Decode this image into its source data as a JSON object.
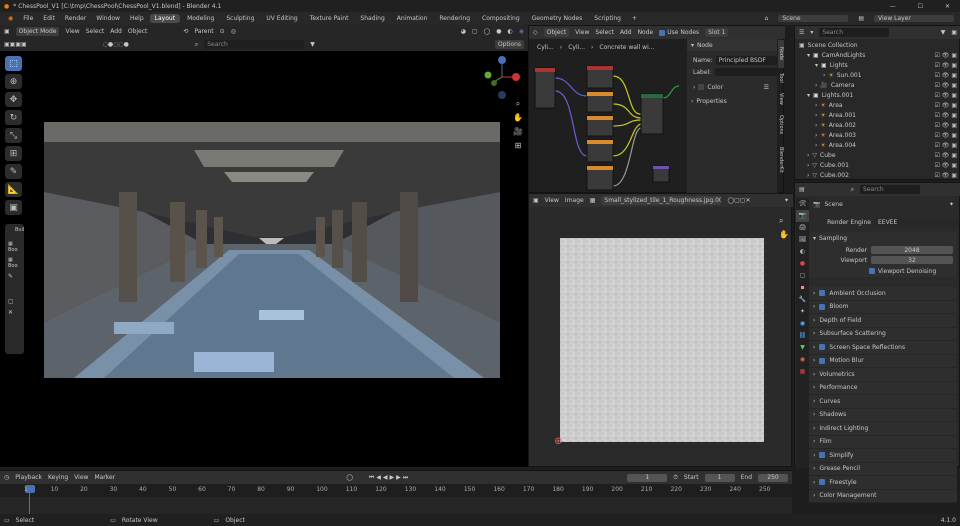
{
  "window": {
    "title": "* ChessPool_V1 [C:\\tmp\\ChessPool\\ChessPool_V1.blend] - Blender 4.1",
    "controls": [
      "—",
      "☐",
      "✕"
    ]
  },
  "menu": [
    "File",
    "Edit",
    "Render",
    "Window",
    "Help"
  ],
  "workspaces": [
    "Layout",
    "Modeling",
    "Sculpting",
    "UV Editing",
    "Texture Paint",
    "Shading",
    "Animation",
    "Rendering",
    "Compositing",
    "Geometry Nodes",
    "Scripting"
  ],
  "active_workspace": "Layout",
  "scene_name": "Scene",
  "view_layer": "View Layer",
  "viewport": {
    "mode": "Object Mode",
    "menus": [
      "View",
      "Select",
      "Add",
      "Object"
    ],
    "pivot": "Parent",
    "search_placeholder": "Search",
    "options_label": "Options",
    "tools_panel_label": "Buil",
    "tools_sub_labels": [
      "Boo",
      "Boo"
    ]
  },
  "node_editor": {
    "type": "Object",
    "menus": [
      "View",
      "Select",
      "Add",
      "Node"
    ],
    "use_nodes": "Use Nodes",
    "slot": "Slot 1",
    "breadcrumb": [
      "Cyli...",
      "Cyli...",
      "Concrete wall wi..."
    ],
    "side_panel_title": "Node",
    "name_label": "Name:",
    "name_value": "Principled BSDF",
    "label_label": "Label:",
    "color_label": "Color",
    "properties_label": "Properties",
    "tabs": [
      "Node",
      "Tool",
      "View",
      "Options",
      "BlenderKit"
    ]
  },
  "image_editor": {
    "menus": [
      "View",
      "Image"
    ],
    "image_name": "Small_stylized_tile_1_Roughness.jpg.001"
  },
  "outliner": {
    "search_placeholder": "Search",
    "root": "Scene Collection",
    "rows": [
      {
        "label": "CamAndLights",
        "indent": 1,
        "icon": "collection"
      },
      {
        "label": "Lights",
        "indent": 2,
        "icon": "collection"
      },
      {
        "label": "Sun.001",
        "indent": 3,
        "icon": "light"
      },
      {
        "label": "Camera",
        "indent": 2,
        "icon": "camera"
      },
      {
        "label": "Lights.001",
        "indent": 1,
        "icon": "collection"
      },
      {
        "label": "Area",
        "indent": 2,
        "icon": "light"
      },
      {
        "label": "Area.001",
        "indent": 2,
        "icon": "light"
      },
      {
        "label": "Area.002",
        "indent": 2,
        "icon": "light"
      },
      {
        "label": "Area.003",
        "indent": 2,
        "icon": "light"
      },
      {
        "label": "Area.004",
        "indent": 2,
        "icon": "light"
      },
      {
        "label": "Cube",
        "indent": 1,
        "icon": "mesh"
      },
      {
        "label": "Cube.001",
        "indent": 1,
        "icon": "mesh"
      },
      {
        "label": "Cube.002",
        "indent": 1,
        "icon": "mesh"
      }
    ]
  },
  "properties": {
    "search_placeholder": "Search",
    "context": "Scene",
    "render_engine_label": "Render Engine",
    "render_engine": "EEVEE",
    "sampling_label": "Sampling",
    "render_label": "Render",
    "render_samples": "2048",
    "viewport_label": "Viewport",
    "viewport_samples": "32",
    "denoising_label": "Viewport Denoising",
    "panels": [
      {
        "label": "Ambient Occlusion",
        "check": true
      },
      {
        "label": "Bloom",
        "check": true
      },
      {
        "label": "Depth of Field",
        "check": false
      },
      {
        "label": "Subsurface Scattering",
        "check": false
      },
      {
        "label": "Screen Space Reflections",
        "check": true
      },
      {
        "label": "Motion Blur",
        "check": true
      },
      {
        "label": "Volumetrics",
        "check": false
      },
      {
        "label": "Performance",
        "check": false
      },
      {
        "label": "Curves",
        "check": false
      },
      {
        "label": "Shadows",
        "check": false
      },
      {
        "label": "Indirect Lighting",
        "check": false
      },
      {
        "label": "Film",
        "check": false
      },
      {
        "label": "Simplify",
        "check": true
      },
      {
        "label": "Grease Pencil",
        "check": false
      },
      {
        "label": "Freestyle",
        "check": true
      },
      {
        "label": "Color Management",
        "check": false
      }
    ]
  },
  "timeline": {
    "menus": [
      "Playback",
      "Keying",
      "View",
      "Marker"
    ],
    "current_frame": "1",
    "start_label": "Start",
    "start": "1",
    "end_label": "End",
    "end": "250",
    "ticks": [
      "1",
      "10",
      "20",
      "30",
      "40",
      "50",
      "60",
      "70",
      "80",
      "90",
      "100",
      "110",
      "120",
      "130",
      "140",
      "150",
      "160",
      "170",
      "180",
      "190",
      "200",
      "210",
      "220",
      "230",
      "240",
      "250"
    ]
  },
  "statusbar": {
    "items": [
      "Select",
      "Rotate View",
      "Object"
    ],
    "version": "4.1.0"
  },
  "colors": {
    "accent": "#4772b3",
    "node_green": "#2a6b3a",
    "node_red": "#a33",
    "node_purple": "#6b55b0",
    "node_orange": "#d98a2c",
    "noodle_yellow": "#c7c729",
    "noodle_purple": "#6b5fd1"
  }
}
